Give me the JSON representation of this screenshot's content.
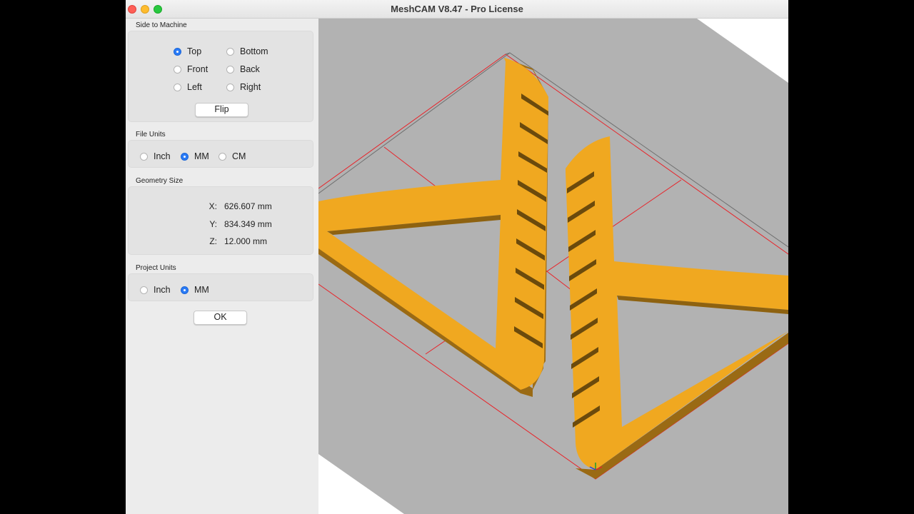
{
  "window": {
    "title": "MeshCAM V8.47 - Pro License"
  },
  "side_to_machine": {
    "label": "Side to Machine",
    "options": [
      "Top",
      "Bottom",
      "Front",
      "Back",
      "Left",
      "Right"
    ],
    "selected": "Top",
    "flip_label": "Flip"
  },
  "file_units": {
    "label": "File Units",
    "options": [
      "Inch",
      "MM",
      "CM"
    ],
    "selected": "MM"
  },
  "geometry_size": {
    "label": "Geometry Size",
    "x_label": "X:",
    "x_value": "626.607 mm",
    "y_label": "Y:",
    "y_value": "834.349 mm",
    "z_label": "Z:",
    "z_value": "12.000 mm"
  },
  "project_units": {
    "label": "Project Units",
    "options": [
      "Inch",
      "MM"
    ],
    "selected": "MM"
  },
  "ok_label": "OK",
  "colors": {
    "part_top": "#f0a820",
    "part_side": "#9a6a14",
    "bed_gray": "#b2b2b2",
    "bounds_red": "#e8242a",
    "selected_radio": "#2a7bf6"
  }
}
